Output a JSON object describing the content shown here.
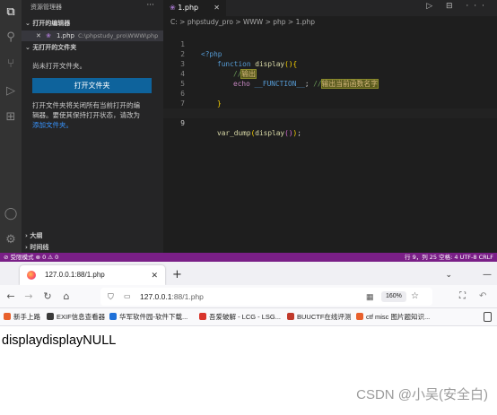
{
  "vscode": {
    "explorer": {
      "title": "资源管理器",
      "more": "···",
      "open_editors_header": "打开的编辑器",
      "open_file": {
        "close": "✕",
        "name": "1.php",
        "path": "C:\\phpstudy_pro\\WWW\\php"
      },
      "no_folder_header": "无打开的文件夹",
      "no_folder_msg": "尚未打开文件夹。",
      "open_folder_button": "打开文件夹",
      "hint_msg_1": "打开文件夹将关闭所有当前打开的编",
      "hint_msg_2": "辑器。要使其保持打开状态，请改为",
      "hint_link": "添加文件夹。",
      "outline_header": "大纲",
      "timeline_header": "时间线"
    },
    "editor": {
      "tab_label": "1.php",
      "tab_close": "✕",
      "tab_tools": "▷ ⊟ ···",
      "breadcrumb": "C: > phpstudy_pro > WWW > php > 1.php",
      "lines": [
        {
          "n": "1",
          "t": "<?php"
        },
        {
          "n": "2",
          "t": "function display(){"
        },
        {
          "n": "3",
          "t": "//输出"
        },
        {
          "n": "4",
          "t": "echo __FUNCTION__; //输出当前函数名字"
        },
        {
          "n": "5",
          "t": ""
        },
        {
          "n": "6",
          "t": "}"
        },
        {
          "n": "7",
          "t": "display();"
        },
        {
          "n": "8",
          "t": ""
        },
        {
          "n": "9",
          "t": "var_dump(display());"
        }
      ]
    },
    "status": {
      "left": "⊘ 受限模式    ⊗ 0 ⚠ 0",
      "right": "行 9，列 25    空格: 4    UTF-8    CRLF"
    }
  },
  "browser": {
    "tab_title": "127.0.0.1:88/1.php",
    "tab_close": "✕",
    "new_tab": "+",
    "tab_list": "⌄",
    "minimize": "—",
    "url_host": "127.0.0.1",
    "url_path": ":88/1.php",
    "zoom": "160%",
    "bookmarks": [
      {
        "label": "新手上路",
        "color": "#e8602c"
      },
      {
        "label": "EXIF信息查看器",
        "color": "#3a3a3a"
      },
      {
        "label": "华军软件园-软件下载...",
        "color": "#1d6fd8"
      },
      {
        "label": "吾爱破解 - LCG - LSG...",
        "color": "#d8342b"
      },
      {
        "label": "BUUCTF在线评测",
        "color": "#c0392b"
      },
      {
        "label": "ctf misc 图片题知识...",
        "color": "#e8602c"
      }
    ],
    "page_output": "displaydisplayNULL"
  },
  "watermark": "CSDN @小吴(安全白)"
}
